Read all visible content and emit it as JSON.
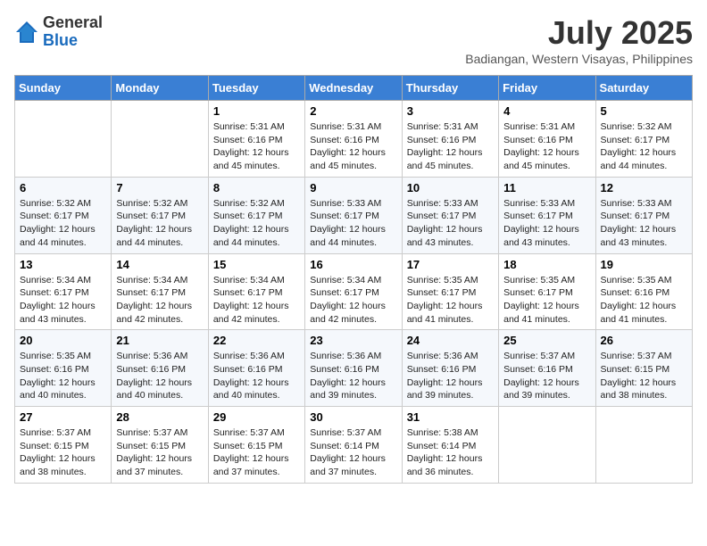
{
  "header": {
    "logo_general": "General",
    "logo_blue": "Blue",
    "month_year": "July 2025",
    "location": "Badiangan, Western Visayas, Philippines"
  },
  "days_of_week": [
    "Sunday",
    "Monday",
    "Tuesday",
    "Wednesday",
    "Thursday",
    "Friday",
    "Saturday"
  ],
  "weeks": [
    [
      {
        "day": "",
        "info": ""
      },
      {
        "day": "",
        "info": ""
      },
      {
        "day": "1",
        "info": "Sunrise: 5:31 AM\nSunset: 6:16 PM\nDaylight: 12 hours and 45 minutes."
      },
      {
        "day": "2",
        "info": "Sunrise: 5:31 AM\nSunset: 6:16 PM\nDaylight: 12 hours and 45 minutes."
      },
      {
        "day": "3",
        "info": "Sunrise: 5:31 AM\nSunset: 6:16 PM\nDaylight: 12 hours and 45 minutes."
      },
      {
        "day": "4",
        "info": "Sunrise: 5:31 AM\nSunset: 6:16 PM\nDaylight: 12 hours and 45 minutes."
      },
      {
        "day": "5",
        "info": "Sunrise: 5:32 AM\nSunset: 6:17 PM\nDaylight: 12 hours and 44 minutes."
      }
    ],
    [
      {
        "day": "6",
        "info": "Sunrise: 5:32 AM\nSunset: 6:17 PM\nDaylight: 12 hours and 44 minutes."
      },
      {
        "day": "7",
        "info": "Sunrise: 5:32 AM\nSunset: 6:17 PM\nDaylight: 12 hours and 44 minutes."
      },
      {
        "day": "8",
        "info": "Sunrise: 5:32 AM\nSunset: 6:17 PM\nDaylight: 12 hours and 44 minutes."
      },
      {
        "day": "9",
        "info": "Sunrise: 5:33 AM\nSunset: 6:17 PM\nDaylight: 12 hours and 44 minutes."
      },
      {
        "day": "10",
        "info": "Sunrise: 5:33 AM\nSunset: 6:17 PM\nDaylight: 12 hours and 43 minutes."
      },
      {
        "day": "11",
        "info": "Sunrise: 5:33 AM\nSunset: 6:17 PM\nDaylight: 12 hours and 43 minutes."
      },
      {
        "day": "12",
        "info": "Sunrise: 5:33 AM\nSunset: 6:17 PM\nDaylight: 12 hours and 43 minutes."
      }
    ],
    [
      {
        "day": "13",
        "info": "Sunrise: 5:34 AM\nSunset: 6:17 PM\nDaylight: 12 hours and 43 minutes."
      },
      {
        "day": "14",
        "info": "Sunrise: 5:34 AM\nSunset: 6:17 PM\nDaylight: 12 hours and 42 minutes."
      },
      {
        "day": "15",
        "info": "Sunrise: 5:34 AM\nSunset: 6:17 PM\nDaylight: 12 hours and 42 minutes."
      },
      {
        "day": "16",
        "info": "Sunrise: 5:34 AM\nSunset: 6:17 PM\nDaylight: 12 hours and 42 minutes."
      },
      {
        "day": "17",
        "info": "Sunrise: 5:35 AM\nSunset: 6:17 PM\nDaylight: 12 hours and 41 minutes."
      },
      {
        "day": "18",
        "info": "Sunrise: 5:35 AM\nSunset: 6:17 PM\nDaylight: 12 hours and 41 minutes."
      },
      {
        "day": "19",
        "info": "Sunrise: 5:35 AM\nSunset: 6:16 PM\nDaylight: 12 hours and 41 minutes."
      }
    ],
    [
      {
        "day": "20",
        "info": "Sunrise: 5:35 AM\nSunset: 6:16 PM\nDaylight: 12 hours and 40 minutes."
      },
      {
        "day": "21",
        "info": "Sunrise: 5:36 AM\nSunset: 6:16 PM\nDaylight: 12 hours and 40 minutes."
      },
      {
        "day": "22",
        "info": "Sunrise: 5:36 AM\nSunset: 6:16 PM\nDaylight: 12 hours and 40 minutes."
      },
      {
        "day": "23",
        "info": "Sunrise: 5:36 AM\nSunset: 6:16 PM\nDaylight: 12 hours and 39 minutes."
      },
      {
        "day": "24",
        "info": "Sunrise: 5:36 AM\nSunset: 6:16 PM\nDaylight: 12 hours and 39 minutes."
      },
      {
        "day": "25",
        "info": "Sunrise: 5:37 AM\nSunset: 6:16 PM\nDaylight: 12 hours and 39 minutes."
      },
      {
        "day": "26",
        "info": "Sunrise: 5:37 AM\nSunset: 6:15 PM\nDaylight: 12 hours and 38 minutes."
      }
    ],
    [
      {
        "day": "27",
        "info": "Sunrise: 5:37 AM\nSunset: 6:15 PM\nDaylight: 12 hours and 38 minutes."
      },
      {
        "day": "28",
        "info": "Sunrise: 5:37 AM\nSunset: 6:15 PM\nDaylight: 12 hours and 37 minutes."
      },
      {
        "day": "29",
        "info": "Sunrise: 5:37 AM\nSunset: 6:15 PM\nDaylight: 12 hours and 37 minutes."
      },
      {
        "day": "30",
        "info": "Sunrise: 5:37 AM\nSunset: 6:14 PM\nDaylight: 12 hours and 37 minutes."
      },
      {
        "day": "31",
        "info": "Sunrise: 5:38 AM\nSunset: 6:14 PM\nDaylight: 12 hours and 36 minutes."
      },
      {
        "day": "",
        "info": ""
      },
      {
        "day": "",
        "info": ""
      }
    ]
  ]
}
